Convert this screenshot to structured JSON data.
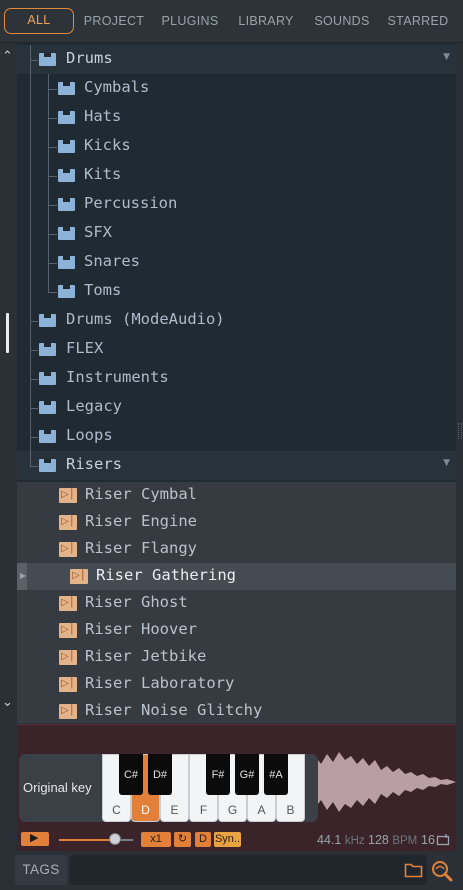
{
  "tabs": [
    {
      "label": "ALL",
      "active": true
    },
    {
      "label": "PROJECT"
    },
    {
      "label": "PLUGINS"
    },
    {
      "label": "LIBRARY"
    },
    {
      "label": "SOUNDS"
    },
    {
      "label": "STARRED"
    }
  ],
  "tree": {
    "drums": {
      "label": "Drums",
      "expanded": true
    },
    "drum_children": [
      "Cymbals",
      "Hats",
      "Kicks",
      "Kits",
      "Percussion",
      "SFX",
      "Snares",
      "Toms"
    ],
    "folders": [
      "Drums (ModeAudio)",
      "FLEX",
      "Instruments",
      "Legacy",
      "Loops"
    ],
    "risers": {
      "label": "Risers",
      "expanded": true
    },
    "files": [
      "Riser Cymbal",
      "Riser Engine",
      "Riser Flangy",
      "Riser Gathering",
      "Riser Ghost",
      "Riser Hoover",
      "Riser Jetbike",
      "Riser Laboratory",
      "Riser Noise Glitchy"
    ],
    "selected_file": "Riser Gathering"
  },
  "icons": {
    "folder": "folder-icon",
    "audio": "audio-file-icon"
  },
  "colors": {
    "accent": "#e2803a",
    "folder": "#8db2d8",
    "audio_icon": "#e3b48a"
  },
  "preview": {
    "original_key_label": "Original key",
    "white_keys": [
      "C",
      "D",
      "E",
      "F",
      "G",
      "A",
      "B"
    ],
    "black_keys": [
      "C#",
      "D#",
      "F#",
      "G#",
      "#A"
    ],
    "selected_key": "D",
    "speed": "x1",
    "key_badge": "D",
    "sync_label": "Syn..",
    "sample_rate": "44.1",
    "sample_rate_unit": "kHz",
    "tempo": "128",
    "tempo_unit": "BPM",
    "bits": "16"
  },
  "bottom": {
    "tags_label": "TAGS"
  }
}
